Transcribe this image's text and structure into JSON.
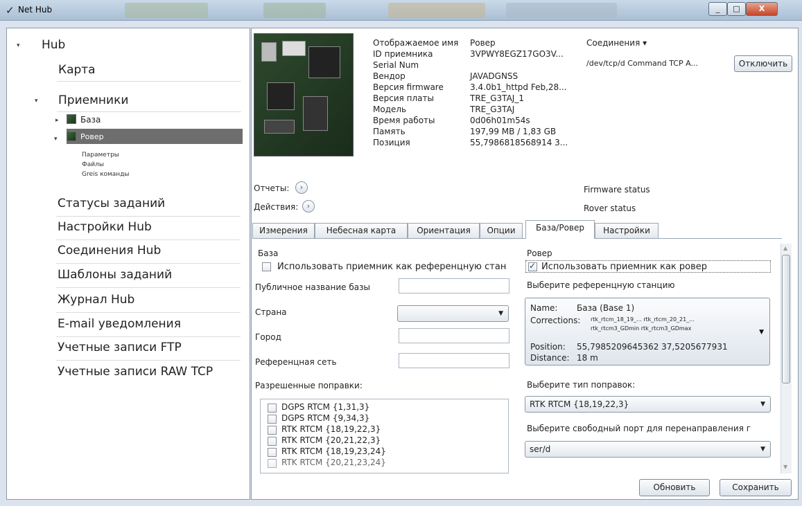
{
  "window": {
    "title": "Net Hub",
    "min": "_",
    "max": "□",
    "close": "X"
  },
  "sidebar": {
    "hub": "Hub",
    "map": "Карта",
    "receivers": "Приемники",
    "base": "База",
    "rover": "Ровер",
    "rover_sub": [
      "Параметры",
      "Файлы",
      "Greis команды"
    ],
    "items": [
      "Статусы заданий",
      "Настройки Hub",
      "Соединения Hub",
      "Шаблоны заданий",
      "Журнал Hub",
      "E-mail уведомления",
      "Учетные записи FTP",
      "Учетные записи RAW TCP"
    ]
  },
  "info": {
    "labels": [
      "Отображаемое имя",
      "ID приемника",
      "Serial Num",
      "Вендор",
      "Версия firmware",
      "Версия платы",
      "Модель",
      "Время работы",
      "Память",
      "Позиция"
    ],
    "values": [
      "Ровер",
      "3VPWY8EGZ17GO3V...",
      "",
      "JAVADGNSS",
      "3.4.0b1_httpd Feb,28...",
      "TRE_G3TAJ_1",
      "TRE_G3TAJ",
      "0d06h01m54s",
      "197,99 MB / 1,83 GB",
      "55,7986818568914 3..."
    ]
  },
  "connections": {
    "label": "Соединения ▾",
    "value": "/dev/tcp/d Command TCP A...",
    "disconnect": "Отключить"
  },
  "reports": {
    "label": "Отчеты:",
    "actions": "Действия:",
    "firmware_status": "Firmware status",
    "rover_status": "Rover status"
  },
  "tabs": [
    "Измерения",
    "Небесная карта",
    "Ориентация",
    "Опции",
    "База/Ровер",
    "Настройки"
  ],
  "base": {
    "title": "База",
    "use_as_ref": "Использовать приемник как референцную стан",
    "public_name": "Публичное название базы",
    "country": "Страна",
    "city": "Город",
    "ref_net": "Референцная сеть",
    "allowed": "Разрешенные поправки:",
    "corrections": [
      "DGPS RTCM {1,31,3}",
      "DGPS RTCM {9,34,3}",
      "RTK RTCM {18,19,22,3}",
      "RTK RTCM {20,21,22,3}",
      "RTK RTCM {18,19,23,24}",
      "RTK RTCM {20,21,23,24}"
    ]
  },
  "rover": {
    "title": "Ровер",
    "use_as_rover": "Использовать приемник как ровер",
    "choose_ref": "Выберите референцную станцию",
    "name_label": "Name:",
    "name_value": "База (Base 1)",
    "corr_label": "Corrections:",
    "corr_value_1": "rtk_rtcm_18_19_... rtk_rtcm_20_21_...",
    "corr_value_2": "rtk_rtcm3_GDmin rtk_rtcm3_GDmax",
    "pos_label": "Position:",
    "pos_value": "55,7985209645362 37,5205677931",
    "dist_label": "Distance:",
    "dist_value": "18 m",
    "choose_type": "Выберите тип поправок:",
    "type_value": "RTK RTCM {18,19,22,3}",
    "choose_port": "Выберите свободный порт для перенаправления г",
    "port_value": "ser/d"
  },
  "buttons": {
    "refresh": "Обновить",
    "save": "Сохранить"
  }
}
